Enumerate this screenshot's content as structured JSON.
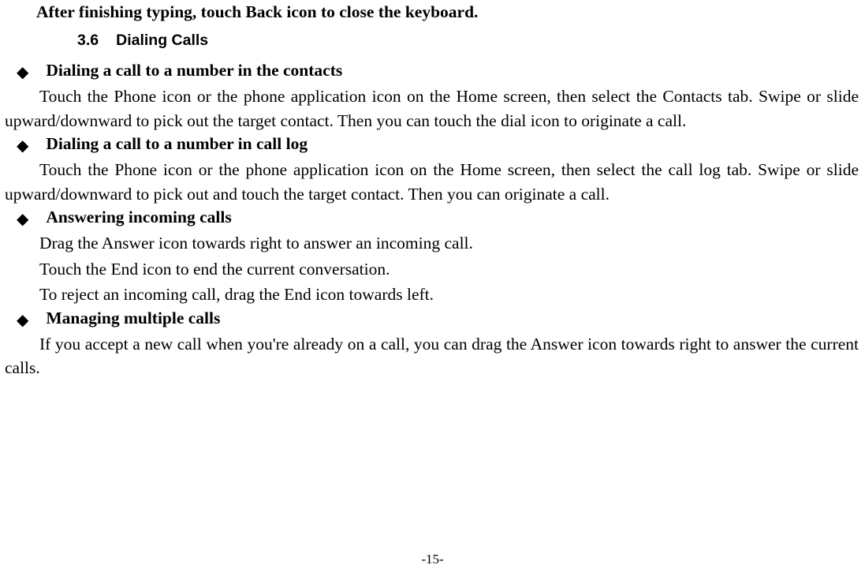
{
  "intro": "After finishing typing, touch Back icon to close the keyboard.",
  "section": {
    "number": "3.6",
    "title": "Dialing Calls"
  },
  "bullets": [
    {
      "heading": "Dialing a call to a number in the contacts",
      "paragraphs": [
        "Touch the Phone icon or the phone application icon on the Home screen, then select the Contacts tab. Swipe or slide upward/downward to pick out the target contact. Then you can touch the dial icon to originate a call."
      ]
    },
    {
      "heading": "Dialing a call to a number in call log",
      "paragraphs": [
        "Touch the Phone icon or the phone application icon on the Home screen, then select the call log tab. Swipe or slide upward/downward to pick out and touch the target contact. Then you can originate a call."
      ]
    },
    {
      "heading": "Answering incoming calls",
      "paragraphs": [
        "Drag the Answer icon towards right to answer an incoming call.",
        "Touch the End icon to end the current conversation.",
        "To reject an incoming call, drag the End icon towards left."
      ]
    },
    {
      "heading": "Managing multiple calls",
      "paragraphs": [
        "If you accept a new call when you're already on a call, you can drag the Answer icon towards right to answer the current calls."
      ]
    }
  ],
  "page_number": "-15-"
}
